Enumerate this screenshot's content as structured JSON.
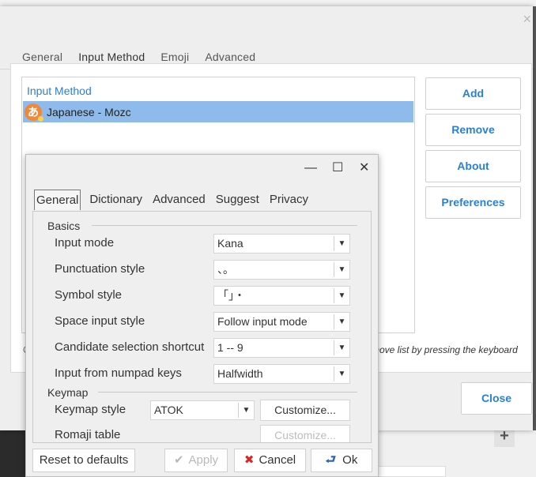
{
  "config_window": {
    "tabs": [
      "General",
      "Input Method",
      "Emoji",
      "Advanced"
    ],
    "active_tab": "Input Method",
    "list_header": "Input Method",
    "input_methods": [
      {
        "label": "Japanese - Mozc",
        "icon": "mozc-hiragana-icon",
        "icon_glyph": "あ"
      }
    ],
    "buttons": {
      "add": "Add",
      "remove": "Remove",
      "about": "About",
      "preferences": "Preferences",
      "close": "Close"
    },
    "hint_left": "C",
    "hint_text": "move list by pressing the keyboard",
    "close_glyph": "×",
    "accent_color": "#2a80d2",
    "selection_color": "#8fbbec"
  },
  "background": {
    "plus_glyph": "+"
  },
  "mozc_dialog": {
    "controls": {
      "minimize": "—",
      "maximize": "☐",
      "close": "✕"
    },
    "tabs": [
      "General",
      "Dictionary",
      "Advanced",
      "Suggest",
      "Privacy"
    ],
    "active_tab": "General",
    "basics": {
      "title": "Basics",
      "rows": [
        {
          "label": "Input mode",
          "value": "Kana"
        },
        {
          "label": "Punctuation style",
          "value": "、。"
        },
        {
          "label": "Symbol style",
          "value": "「」・"
        },
        {
          "label": "Space input style",
          "value": "Follow input mode"
        },
        {
          "label": "Candidate selection shortcut",
          "value": "1 -- 9"
        },
        {
          "label": "Input from numpad keys",
          "value": "Halfwidth"
        }
      ]
    },
    "keymap": {
      "title": "Keymap",
      "style_label": "Keymap style",
      "style_value": "ATOK",
      "customize": "Customize...",
      "romaji_label": "Romaji table",
      "romaji_customize": "Customize..."
    },
    "buttons": {
      "reset": "Reset to defaults",
      "apply": "Apply",
      "cancel": "Cancel",
      "ok": "Ok"
    },
    "icons": {
      "apply": "✔",
      "cancel": "✖",
      "ok": "⮐"
    }
  }
}
